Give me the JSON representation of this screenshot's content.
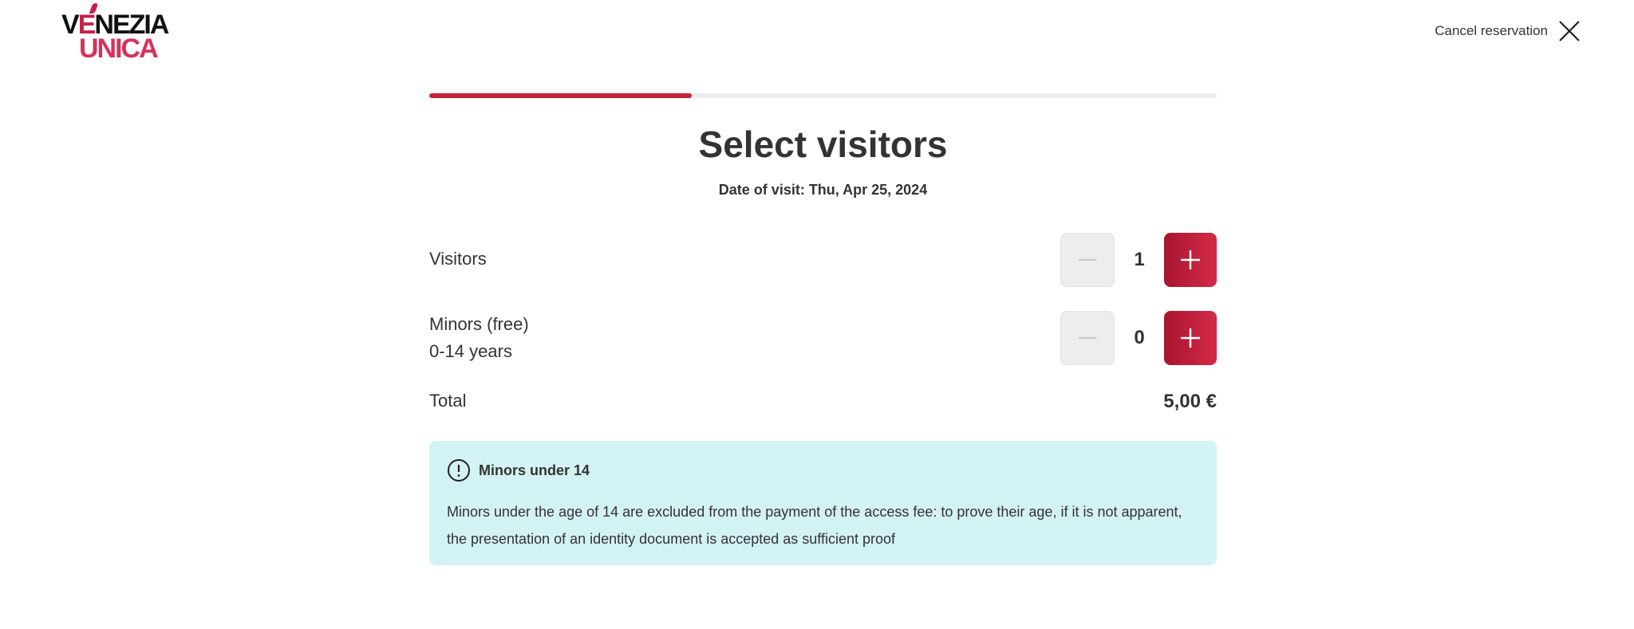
{
  "brand": {
    "logo_line1": "VENEZIA",
    "logo_line2": "UNICA",
    "accent": "#c4223c"
  },
  "header": {
    "cancel_label": "Cancel reservation",
    "close_icon": "close-icon"
  },
  "progress": {
    "fraction": 0.333
  },
  "page": {
    "title": "Select visitors",
    "date_of_visit": "Date of visit: Thu, Apr 25, 2024"
  },
  "visitors": {
    "label": "Visitors",
    "value": "1",
    "minus_icon": "minus-icon",
    "plus_icon": "plus-icon"
  },
  "minors": {
    "label_line1": "Minors (free)",
    "label_line2": "0-14 years",
    "value": "0",
    "minus_icon": "minus-icon",
    "plus_icon": "plus-icon"
  },
  "total": {
    "label": "Total",
    "value": "5,00 €"
  },
  "notice": {
    "icon": "info-icon",
    "title": "Minors under 14",
    "text": "Minors under the age of 14 are excluded from the payment of the access fee: to prove their age, if it is not apparent, the presentation of an identity document is accepted as sufficient proof",
    "background": "#d3f2f4"
  }
}
